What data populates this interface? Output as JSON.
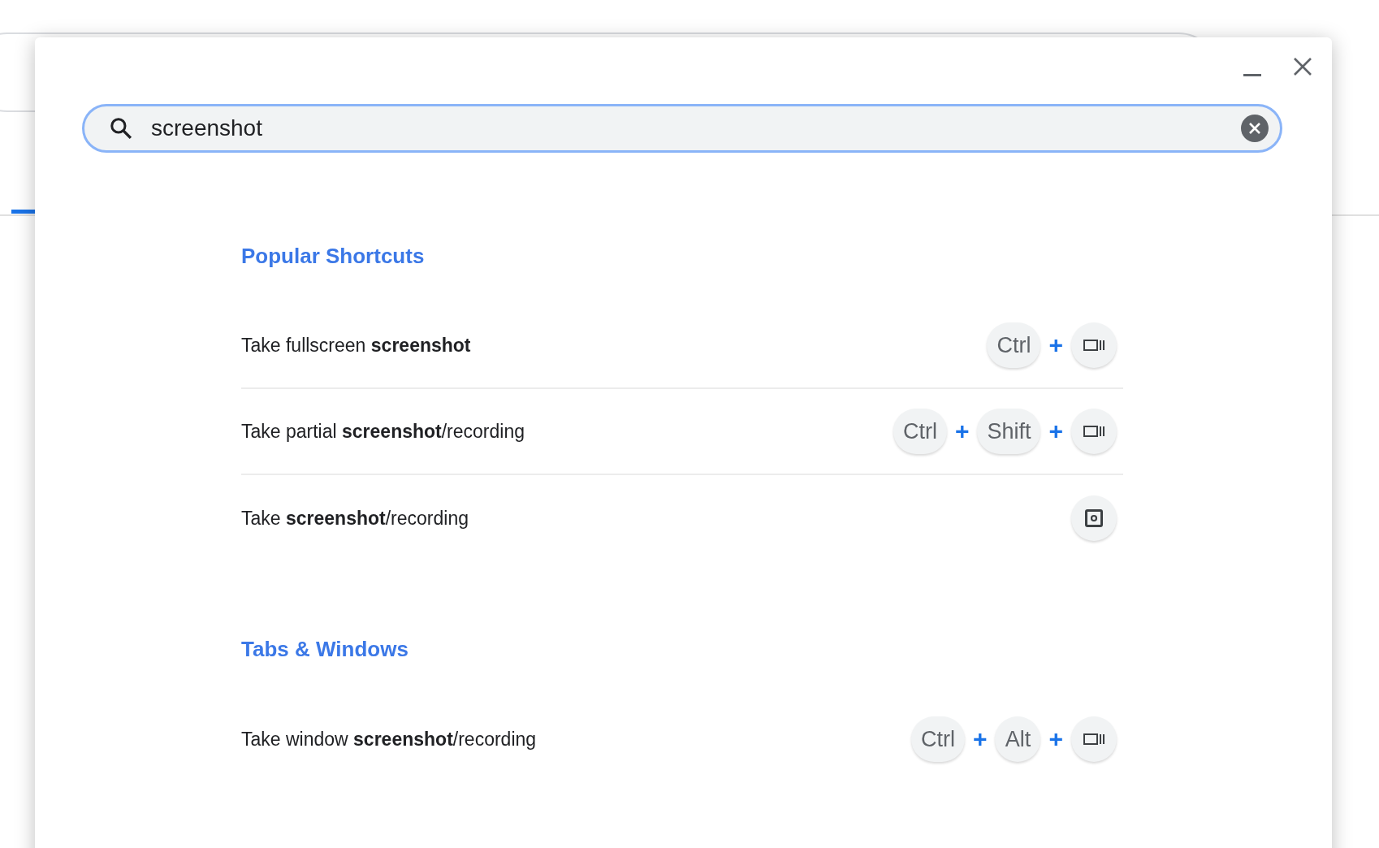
{
  "window": {
    "controls": [
      {
        "kind": "minimize"
      },
      {
        "kind": "close"
      }
    ]
  },
  "search": {
    "value": "screenshot"
  },
  "sections": [
    {
      "title": "Popular Shortcuts",
      "shortcuts": [
        {
          "description": "Take fullscreen **screenshot**",
          "keys": [
            {
              "kind": "text",
              "label": "Ctrl"
            },
            {
              "kind": "plus",
              "label": "+"
            },
            {
              "kind": "overview"
            }
          ]
        },
        {
          "description": "Take partial **screenshot**/recording",
          "keys": [
            {
              "kind": "text",
              "label": "Ctrl"
            },
            {
              "kind": "plus",
              "label": "+"
            },
            {
              "kind": "text",
              "label": "Shift"
            },
            {
              "kind": "plus",
              "label": "+"
            },
            {
              "kind": "overview"
            }
          ]
        },
        {
          "description": "Take **screenshot**/recording",
          "keys": [
            {
              "kind": "capture"
            }
          ]
        }
      ]
    },
    {
      "title": "Tabs & Windows",
      "shortcuts": [
        {
          "description": "Take window **screenshot**/recording",
          "keys": [
            {
              "kind": "text",
              "label": "Ctrl"
            },
            {
              "kind": "plus",
              "label": "+"
            },
            {
              "kind": "text",
              "label": "Alt"
            },
            {
              "kind": "plus",
              "label": "+"
            },
            {
              "kind": "overview"
            }
          ]
        }
      ]
    }
  ]
}
